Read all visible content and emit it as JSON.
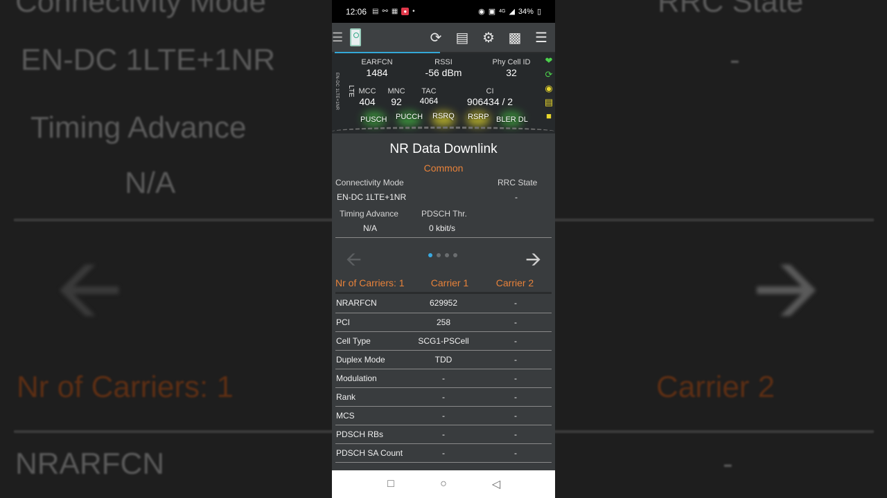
{
  "status": {
    "time": "12:06",
    "battery": "34%",
    "network": "4G"
  },
  "toolbar": {
    "icons": [
      "refresh-icon",
      "log-icon",
      "settings-icon",
      "camera-icon",
      "sort-icon"
    ]
  },
  "cell": {
    "mode_vertical": "EN-DC 1LTE+1NR",
    "tech": "LTE",
    "earfcn_label": "EARFCN",
    "earfcn": "1484",
    "rssi_label": "RSSI",
    "rssi": "-56 dBm",
    "pci_label": "Phy Cell ID",
    "pci": "32",
    "mcc_label": "MCC",
    "mcc": "404",
    "mnc_label": "MNC",
    "mnc": "92",
    "tac_label": "TAC",
    "tac": "4064",
    "ci_label": "CI",
    "ci": "906434 / 2",
    "meas": [
      "PUSCH",
      "PUCCH",
      "RSRQ",
      "RSRP",
      "BLER DL"
    ]
  },
  "page": {
    "title": "NR Data Downlink",
    "section": "Common",
    "conn_label": "Connectivity Mode",
    "conn_value": "EN-DC 1LTE+1NR",
    "rrc_label": "RRC State",
    "rrc_value": "-",
    "ta_label": "Timing Advance",
    "ta_value": "N/A",
    "pdsch_label": "PDSCH Thr.",
    "pdsch_value": "0 kbit/s"
  },
  "carriers": {
    "count_label": "Nr of Carriers: 1",
    "c1": "Carrier 1",
    "c2": "Carrier 2"
  },
  "rows": [
    {
      "name": "NRARFCN",
      "c1": "629952",
      "c2": "-"
    },
    {
      "name": "PCI",
      "c1": "258",
      "c2": "-"
    },
    {
      "name": "Cell Type",
      "c1": "SCG1-PSCell",
      "c2": "-"
    },
    {
      "name": "Duplex Mode",
      "c1": "TDD",
      "c2": "-"
    },
    {
      "name": "Modulation",
      "c1": "-",
      "c2": "-"
    },
    {
      "name": "Rank",
      "c1": "-",
      "c2": "-"
    },
    {
      "name": "MCS",
      "c1": "-",
      "c2": "-"
    },
    {
      "name": "PDSCH RBs",
      "c1": "-",
      "c2": "-"
    },
    {
      "name": "PDSCH SA Count",
      "c1": "-",
      "c2": "-"
    }
  ],
  "colors": {
    "accent": "#e8823a",
    "tab": "#34a8d8",
    "bg": "#393c3e"
  }
}
